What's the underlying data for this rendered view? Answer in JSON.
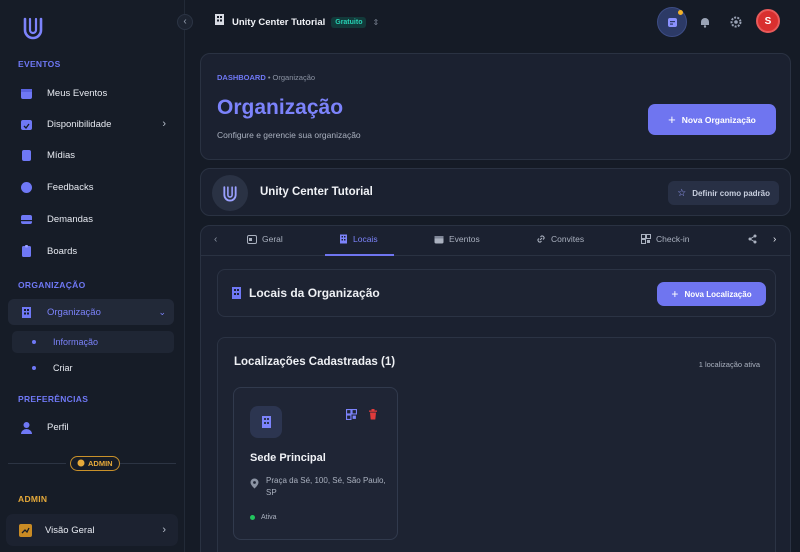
{
  "sidebar": {
    "sections": {
      "eventos": "EVENTOS",
      "organizacao": "ORGANIZAÇÃO",
      "preferencias": "PREFERÊNCIAS",
      "admin": "ADMIN"
    },
    "eventos": [
      {
        "label": "Meus Eventos",
        "icon": "calendar-icon"
      },
      {
        "label": "Disponibilidade",
        "icon": "calendar-check-icon"
      },
      {
        "label": "Mídias",
        "icon": "media-icon"
      },
      {
        "label": "Feedbacks",
        "icon": "chat-icon"
      },
      {
        "label": "Demandas",
        "icon": "inbox-icon"
      },
      {
        "label": "Boards",
        "icon": "board-icon"
      }
    ],
    "organizacao": {
      "label": "Organização",
      "sub": [
        "Informação",
        "Criar"
      ]
    },
    "perfil": "Perfil",
    "admin_badge": "ADMIN",
    "visao_geral": "Visão Geral"
  },
  "topbar": {
    "org_name": "Unity Center Tutorial",
    "plan": "Gratuito",
    "avatar_initial": "S"
  },
  "header": {
    "crumb_root": "DASHBOARD",
    "crumb_sep": " • ",
    "crumb_current": "Organização",
    "title": "Organização",
    "subtitle": "Configure e gerencie sua organização",
    "new_org_button": "Nova Organização"
  },
  "org_card": {
    "name": "Unity Center Tutorial",
    "default_button": "Definir como padrão"
  },
  "tabs": [
    "Geral",
    "Locais",
    "Eventos",
    "Convites",
    "Check-in"
  ],
  "active_tab": "Locais",
  "locais": {
    "title": "Locais da Organização",
    "new_button": "Nova Localização",
    "list_title": "Localizações Cadastradas (1)",
    "count_text": "1 localização ativa",
    "items": [
      {
        "name": "Sede Principal",
        "address": "Praça da Sé, 100, Sé, São Paulo, SP",
        "status": "Ativa"
      }
    ]
  },
  "colors": {
    "accent": "#6f75f0",
    "active_text": "#7c83fb",
    "admin": "#e5a93a",
    "danger": "#e03b3b",
    "success": "#22c55e"
  }
}
